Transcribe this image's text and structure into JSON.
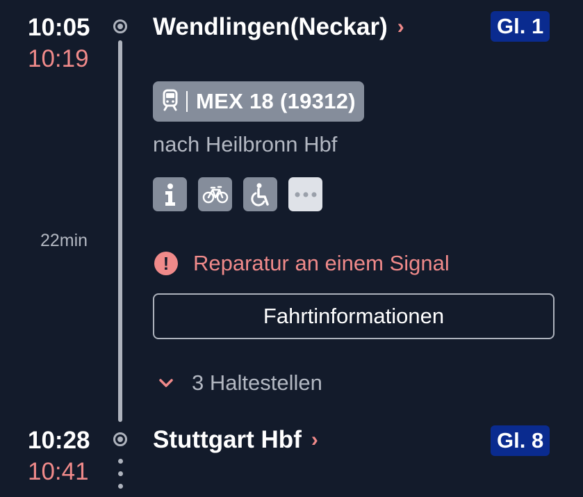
{
  "departure": {
    "time_planned": "10:05",
    "time_actual": "10:19",
    "station": "Wendlingen(Neckar)",
    "platform": "Gl. 1"
  },
  "train": {
    "icon": "train-icon",
    "name": "MEX 18 (19312)",
    "direction": "nach Heilbronn Hbf",
    "amenities": [
      "info-icon",
      "bicycle-icon",
      "wheelchair-icon",
      "more-icon"
    ]
  },
  "duration": "22min",
  "notice": {
    "icon": "exclamation-icon",
    "text": "Reparatur an einem Signal"
  },
  "trip_info_button": "Fahrtinformationen",
  "intermediate_stops": "3 Haltestellen",
  "arrival": {
    "time_planned": "10:28",
    "time_actual": "10:41",
    "station": "Stuttgart Hbf",
    "platform": "Gl. 8"
  },
  "colors": {
    "background": "#131b2b",
    "delay": "#f08a8a",
    "platform": "#0a2b8f",
    "badge": "#858d9b"
  }
}
